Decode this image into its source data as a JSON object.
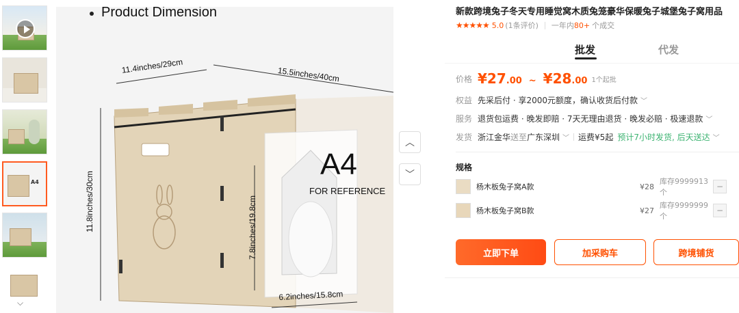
{
  "gallery": {
    "thumbnails": [
      {
        "name": "video-thumb",
        "has_play": true
      },
      {
        "name": "rabbit-outdoor"
      },
      {
        "name": "woman-with-rabbit"
      },
      {
        "name": "dimension-a4",
        "active": true
      },
      {
        "name": "cat-on-house"
      },
      {
        "name": "castle-closeup"
      }
    ],
    "down_arrow": "⌵"
  },
  "main_image": {
    "heading": "Product Dimension",
    "dim_width": "11.4inches/29cm",
    "dim_length": "15.5inches/40cm",
    "dim_height": "11.8inches/30cm",
    "dim_door_height": "7.8inches/19.8cm",
    "dim_door_width": "6.2inches/15.8cm",
    "paper_label": "A4",
    "paper_caption": "FOR REFERENCE"
  },
  "nav": {
    "up": "︿",
    "down": "﹀"
  },
  "product": {
    "title": "新款跨境兔子冬天专用睡觉窝木质兔笼豪华保暖兔子城堡兔子窝用品",
    "stars": "★★★★★",
    "score": "5.0",
    "reviews": "(1条评价)",
    "sales_prefix": "一年内",
    "sales_count": "80+",
    "sales_suffix": "个成交"
  },
  "tabs": {
    "wholesale": "批发",
    "dropship": "代发"
  },
  "pricing": {
    "price_label": "价格",
    "currency": "¥",
    "min_int": "27",
    "min_dec": ".00",
    "separator": "~",
    "max_int": "28",
    "max_dec": ".00",
    "moq": "1个起批",
    "rights_label": "权益",
    "rights_text": "先采后付 · 享2000元额度，确认收货后付款",
    "service_label": "服务",
    "service_text": "退货包运费 · 晚发即赔 · 7天无理由退货 · 晚发必赔 · 极速退款",
    "ship_label": "发货",
    "ship_from": "浙江金华",
    "ship_to_word": "送至",
    "ship_to": "广东深圳",
    "freight": "运费¥5起",
    "promise": "预计7小时发货, 后天送达"
  },
  "specs": {
    "title": "规格",
    "items": [
      {
        "name": "杨木板兔子窝A款",
        "price": "¥28",
        "stock": "库存9999913个",
        "stepper": "−"
      },
      {
        "name": "杨木板兔子窝B款",
        "price": "¥27",
        "stock": "库存9999999个",
        "stepper": "−"
      }
    ]
  },
  "actions": {
    "buy_now": "立即下单",
    "add_cart": "加采购车",
    "cross_border": "跨境铺货"
  },
  "colors": {
    "accent": "#ff5000",
    "wood": "#d9c6a5"
  }
}
